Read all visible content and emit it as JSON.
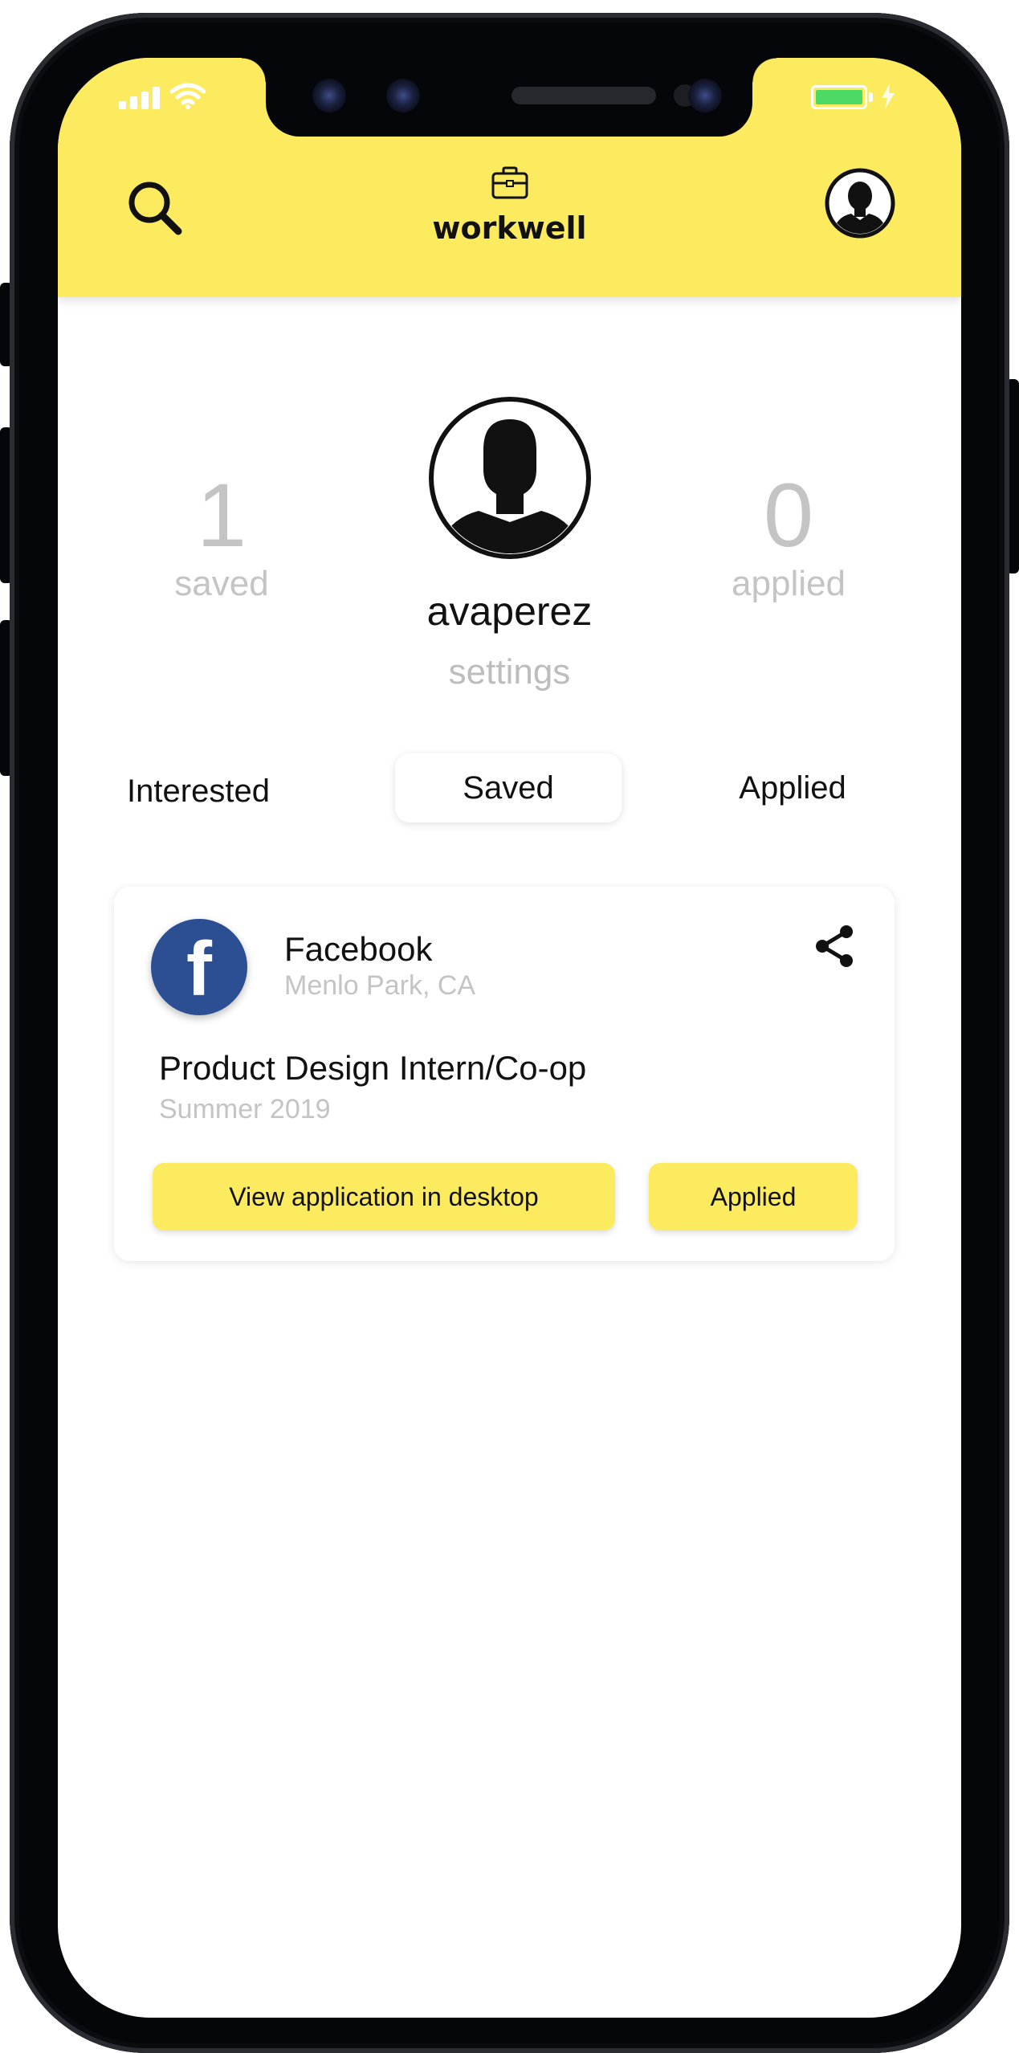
{
  "app": {
    "name": "workwell",
    "accent_color": "#fdeb5f"
  },
  "status_bar": {
    "signal_icon": "signal-bars-icon",
    "wifi_icon": "wifi-icon",
    "battery_icon": "battery-icon",
    "battery_level": 1.0,
    "charging_icon": "charging-bolt-icon"
  },
  "header": {
    "search_icon": "search-icon",
    "logo_icon": "briefcase-icon",
    "title": "workwell",
    "profile_icon": "user-avatar-icon"
  },
  "profile": {
    "saved_count": "1",
    "saved_label": "saved",
    "applied_count": "0",
    "applied_label": "applied",
    "username": "avaperez",
    "settings_label": "settings"
  },
  "tabs": [
    {
      "label": "Interested",
      "active": false
    },
    {
      "label": "Saved",
      "active": true
    },
    {
      "label": "Applied",
      "active": false
    }
  ],
  "job_card": {
    "logo_letter": "f",
    "logo_color": "#2c4f94",
    "company": "Facebook",
    "location": "Menlo Park, CA",
    "title": "Product Design Intern/Co-op",
    "term": "Summer 2019",
    "primary_button": "View application in desktop",
    "status_button": "Applied",
    "share_icon": "share-icon"
  }
}
